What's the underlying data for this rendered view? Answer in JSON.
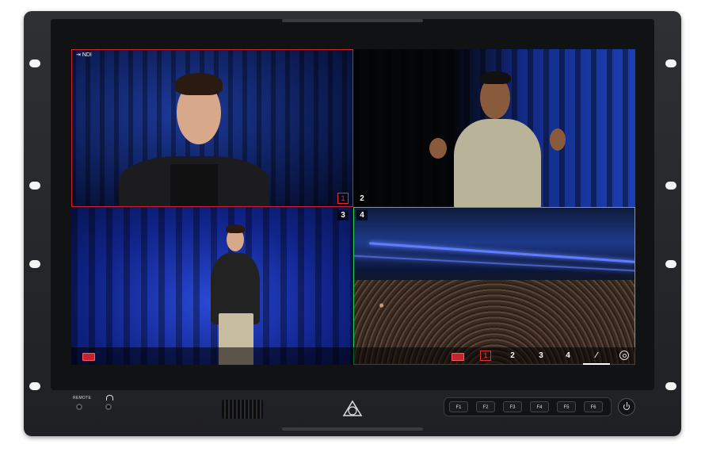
{
  "screen": {
    "ndi_label": "NDI",
    "quads": [
      {
        "number": "1",
        "tally": "1"
      },
      {
        "number": "2"
      },
      {
        "number": "3"
      },
      {
        "number": "4"
      }
    ],
    "overlay_buttons": [
      {
        "label": "1",
        "boxed": true
      },
      {
        "label": "2"
      },
      {
        "label": "3"
      },
      {
        "label": "4"
      },
      {
        "label": "⁄"
      }
    ]
  },
  "hardware": {
    "remote_label": "REMOTE",
    "function_keys": [
      "F1",
      "F2",
      "F3",
      "F4",
      "F5",
      "F6"
    ]
  },
  "colors": {
    "program_tally": "#d0202a",
    "preview_tally": "#2fd04a",
    "chassis": "#2e3033"
  }
}
